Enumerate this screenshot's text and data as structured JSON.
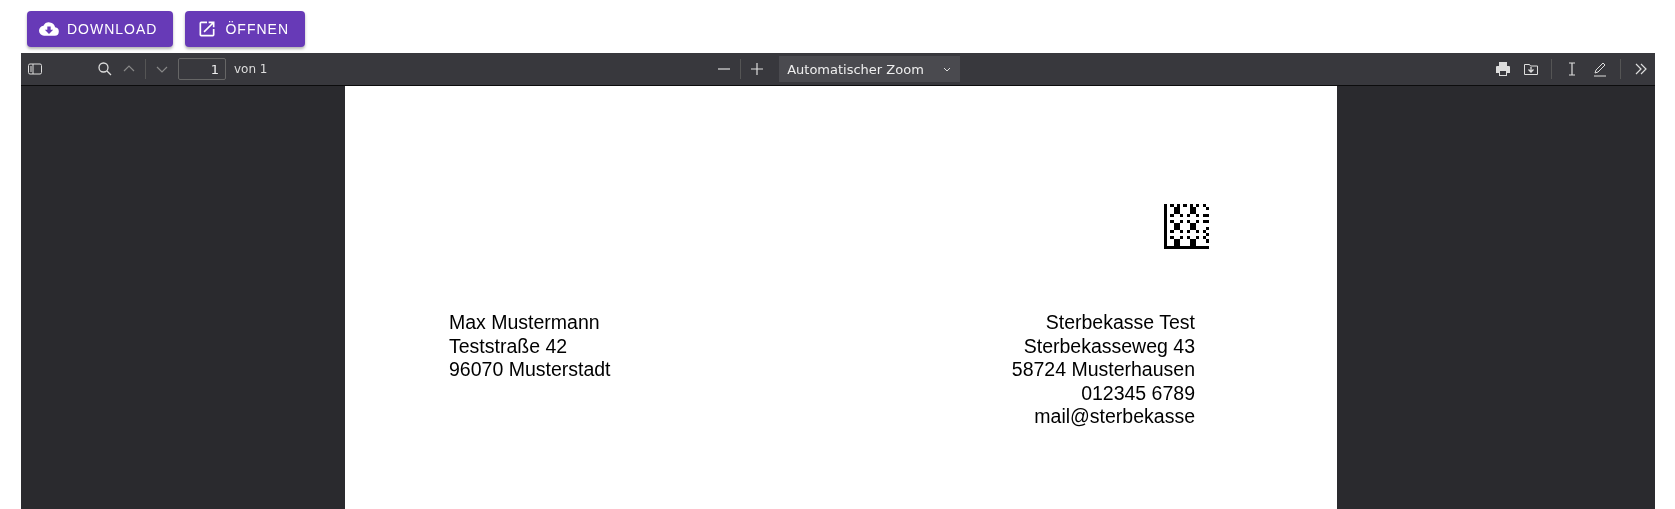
{
  "buttons": [
    {
      "kind": "download",
      "label": "DOWNLOAD"
    },
    {
      "kind": "open",
      "label": "ÖFFNEN"
    }
  ],
  "viewer": {
    "page_number": "1",
    "page_count": "von 1",
    "zoom": "Automatischer Zoom",
    "document": {
      "recipient": [
        "Max Mustermann",
        "Teststraße 42",
        "96070 Musterstadt"
      ],
      "sender": [
        "Sterbekasse Test",
        "Sterbekasseweg 43",
        "58724 Musterhausen",
        "012345 6789",
        "mail@sterbekasse"
      ]
    }
  }
}
